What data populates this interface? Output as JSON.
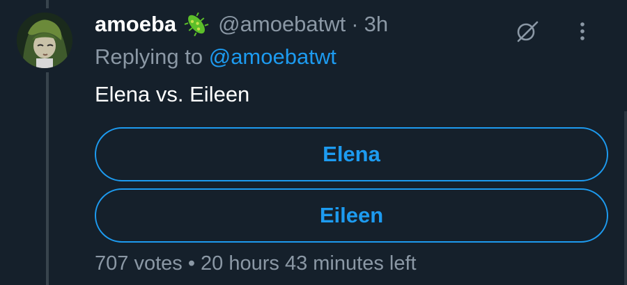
{
  "tweet": {
    "display_name": "amoeba",
    "handle": "@amoebatwt",
    "separator": "·",
    "time": "3h",
    "replying_prefix": "Replying to",
    "replying_to": "@amoebatwt",
    "text": "Elena vs. Eileen"
  },
  "poll": {
    "options": [
      {
        "label": "Elena"
      },
      {
        "label": "Eileen"
      }
    ],
    "votes": "707 votes",
    "bullet": "•",
    "time_left": "20 hours 43 minutes left"
  },
  "icons": {
    "badge": "microbe-emoji-icon",
    "grok": "grok-icon",
    "more": "more-vertical-icon"
  },
  "colors": {
    "background": "#15202b",
    "accent": "#1d9bf0",
    "secondary_text": "#8b98a5",
    "primary_text": "#ffffff"
  }
}
